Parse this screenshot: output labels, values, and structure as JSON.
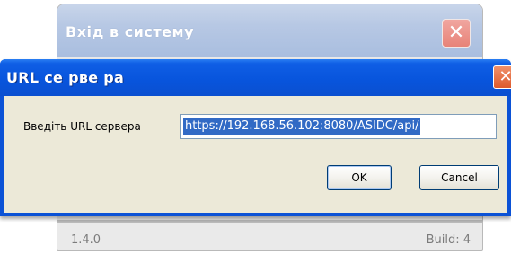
{
  "background_window": {
    "title": "Вхід в систему",
    "close_glyph": "✕",
    "version": "1.4.0",
    "build": "Build: 4"
  },
  "dialog": {
    "title": "URL се рве ра",
    "close_glyph": "✕",
    "url_label": "Введіть URL сервера",
    "url_value": "https://192.168.56.102:8080/ASIDC/api/",
    "ok_label": "OK",
    "cancel_label": "Cancel"
  },
  "icons": {
    "background_close": "close-icon",
    "dialog_close": "close-icon"
  },
  "colors": {
    "titlebar_blue": "#0855dd",
    "close_red": "#dd5a2c",
    "selection": "#316ac5",
    "dialog_body": "#ece9d8"
  }
}
